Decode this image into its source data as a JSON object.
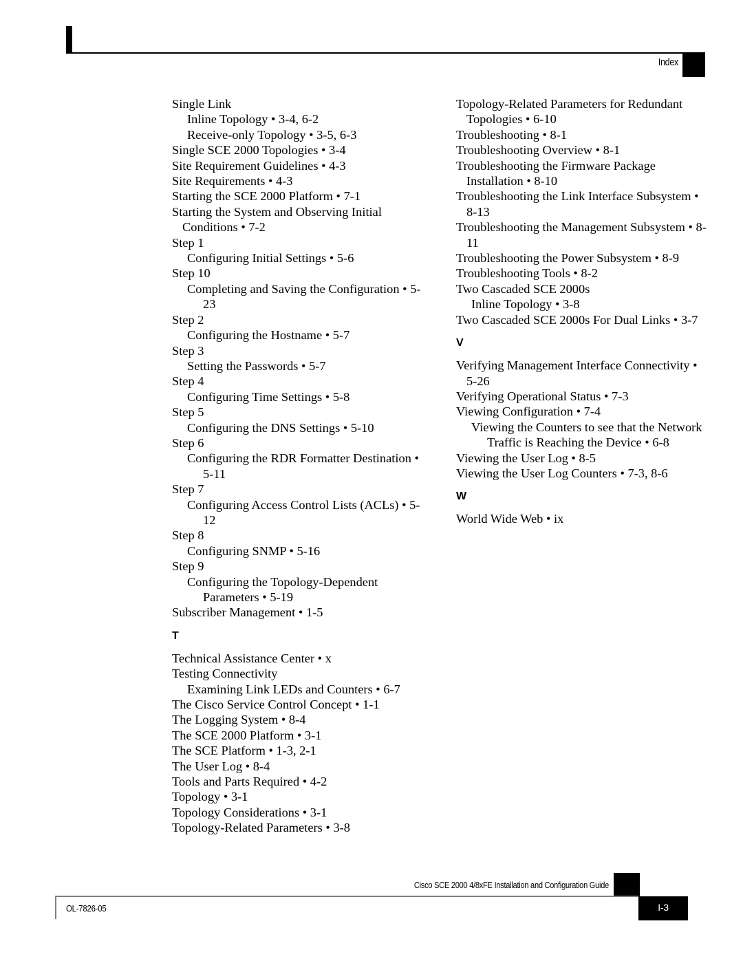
{
  "header": {
    "chapter_label": "Index"
  },
  "footer": {
    "guide_title": "Cisco SCE 2000 4/8xFE Installation and Configuration Guide",
    "doc_id": "OL-7826-05",
    "page_number": "I-3"
  },
  "columns": {
    "left": [
      {
        "kind": "entry",
        "level": 0,
        "text": "Single Link"
      },
      {
        "kind": "entry",
        "level": 1,
        "text": "Inline Topology • 3-4, 6-2"
      },
      {
        "kind": "entry",
        "level": 1,
        "text": "Receive-only Topology • 3-5, 6-3"
      },
      {
        "kind": "entry",
        "level": 0,
        "text": "Single SCE 2000 Topologies • 3-4"
      },
      {
        "kind": "entry",
        "level": 0,
        "text": "Site Requirement Guidelines • 4-3"
      },
      {
        "kind": "entry",
        "level": 0,
        "text": "Site Requirements • 4-3"
      },
      {
        "kind": "entry",
        "level": 0,
        "text": "Starting the SCE 2000 Platform • 7-1"
      },
      {
        "kind": "entry",
        "level": 0,
        "text": "Starting the System and Observing Initial Conditions • 7-2"
      },
      {
        "kind": "entry",
        "level": 0,
        "text": "Step 1"
      },
      {
        "kind": "entry",
        "level": 1,
        "text": "Configuring Initial Settings • 5-6"
      },
      {
        "kind": "entry",
        "level": 0,
        "text": "Step 10"
      },
      {
        "kind": "entry",
        "level": 1,
        "text": "Completing and Saving the Configuration • 5-23"
      },
      {
        "kind": "entry",
        "level": 0,
        "text": "Step 2"
      },
      {
        "kind": "entry",
        "level": 1,
        "text": "Configuring the Hostname • 5-7"
      },
      {
        "kind": "entry",
        "level": 0,
        "text": "Step 3"
      },
      {
        "kind": "entry",
        "level": 1,
        "text": "Setting the Passwords • 5-7"
      },
      {
        "kind": "entry",
        "level": 0,
        "text": "Step 4"
      },
      {
        "kind": "entry",
        "level": 1,
        "text": "Configuring Time Settings • 5-8"
      },
      {
        "kind": "entry",
        "level": 0,
        "text": "Step 5"
      },
      {
        "kind": "entry",
        "level": 1,
        "text": "Configuring the DNS Settings • 5-10"
      },
      {
        "kind": "entry",
        "level": 0,
        "text": "Step 6"
      },
      {
        "kind": "entry",
        "level": 1,
        "text": "Configuring the RDR Formatter Destination • 5-11"
      },
      {
        "kind": "entry",
        "level": 0,
        "text": "Step 7"
      },
      {
        "kind": "entry",
        "level": 1,
        "text": "Configuring Access Control Lists (ACLs) • 5-12"
      },
      {
        "kind": "entry",
        "level": 0,
        "text": "Step 8"
      },
      {
        "kind": "entry",
        "level": 1,
        "text": "Configuring SNMP • 5-16"
      },
      {
        "kind": "entry",
        "level": 0,
        "text": "Step 9"
      },
      {
        "kind": "entry",
        "level": 1,
        "text": "Configuring the Topology-Dependent Parameters • 5-19"
      },
      {
        "kind": "entry",
        "level": 0,
        "text": "Subscriber Management • 1-5"
      },
      {
        "kind": "heading",
        "text": "T"
      },
      {
        "kind": "entry",
        "level": 0,
        "text": "Technical Assistance Center • x"
      },
      {
        "kind": "entry",
        "level": 0,
        "text": "Testing Connectivity"
      },
      {
        "kind": "entry",
        "level": 1,
        "text": "Examining Link LEDs and Counters • 6-7"
      },
      {
        "kind": "entry",
        "level": 0,
        "text": "The Cisco Service Control Concept • 1-1"
      },
      {
        "kind": "entry",
        "level": 0,
        "text": "The Logging System • 8-4"
      },
      {
        "kind": "entry",
        "level": 0,
        "text": "The SCE 2000 Platform • 3-1"
      },
      {
        "kind": "entry",
        "level": 0,
        "text": "The SCE Platform • 1-3, 2-1"
      },
      {
        "kind": "entry",
        "level": 0,
        "text": "The User Log • 8-4"
      },
      {
        "kind": "entry",
        "level": 0,
        "text": "Tools and Parts Required • 4-2"
      },
      {
        "kind": "entry",
        "level": 0,
        "text": "Topology • 3-1"
      },
      {
        "kind": "entry",
        "level": 0,
        "text": "Topology Considerations • 3-1"
      },
      {
        "kind": "entry",
        "level": 0,
        "text": "Topology-Related Parameters • 3-8"
      }
    ],
    "right": [
      {
        "kind": "entry",
        "level": 0,
        "text": "Topology-Related Parameters for Redundant Topologies • 6-10"
      },
      {
        "kind": "entry",
        "level": 0,
        "text": "Troubleshooting • 8-1"
      },
      {
        "kind": "entry",
        "level": 0,
        "text": "Troubleshooting Overview • 8-1"
      },
      {
        "kind": "entry",
        "level": 0,
        "text": "Troubleshooting the Firmware Package Installation • 8-10"
      },
      {
        "kind": "entry",
        "level": 0,
        "text": "Troubleshooting the Link Interface Subsystem • 8-13"
      },
      {
        "kind": "entry",
        "level": 0,
        "text": "Troubleshooting the Management Subsystem • 8-11"
      },
      {
        "kind": "entry",
        "level": 0,
        "text": "Troubleshooting the Power Subsystem • 8-9"
      },
      {
        "kind": "entry",
        "level": 0,
        "text": "Troubleshooting Tools • 8-2"
      },
      {
        "kind": "entry",
        "level": 0,
        "text": "Two Cascaded SCE 2000s"
      },
      {
        "kind": "entry",
        "level": 1,
        "text": "Inline Topology • 3-8"
      },
      {
        "kind": "entry",
        "level": 0,
        "text": "Two Cascaded SCE 2000s For Dual Links • 3-7"
      },
      {
        "kind": "heading",
        "text": "V"
      },
      {
        "kind": "entry",
        "level": 0,
        "text": "Verifying Management Interface Connectivity • 5-26"
      },
      {
        "kind": "entry",
        "level": 0,
        "text": "Verifying Operational Status • 7-3"
      },
      {
        "kind": "entry",
        "level": 0,
        "text": "Viewing Configuration • 7-4"
      },
      {
        "kind": "entry",
        "level": 1,
        "text": "Viewing the Counters to see that the Network Traffic is Reaching the Device • 6-8"
      },
      {
        "kind": "entry",
        "level": 0,
        "text": "Viewing the User Log • 8-5"
      },
      {
        "kind": "entry",
        "level": 0,
        "text": "Viewing the User Log Counters • 7-3, 8-6"
      },
      {
        "kind": "heading",
        "text": "W"
      },
      {
        "kind": "entry",
        "level": 0,
        "text": "World Wide Web • ix"
      }
    ]
  }
}
